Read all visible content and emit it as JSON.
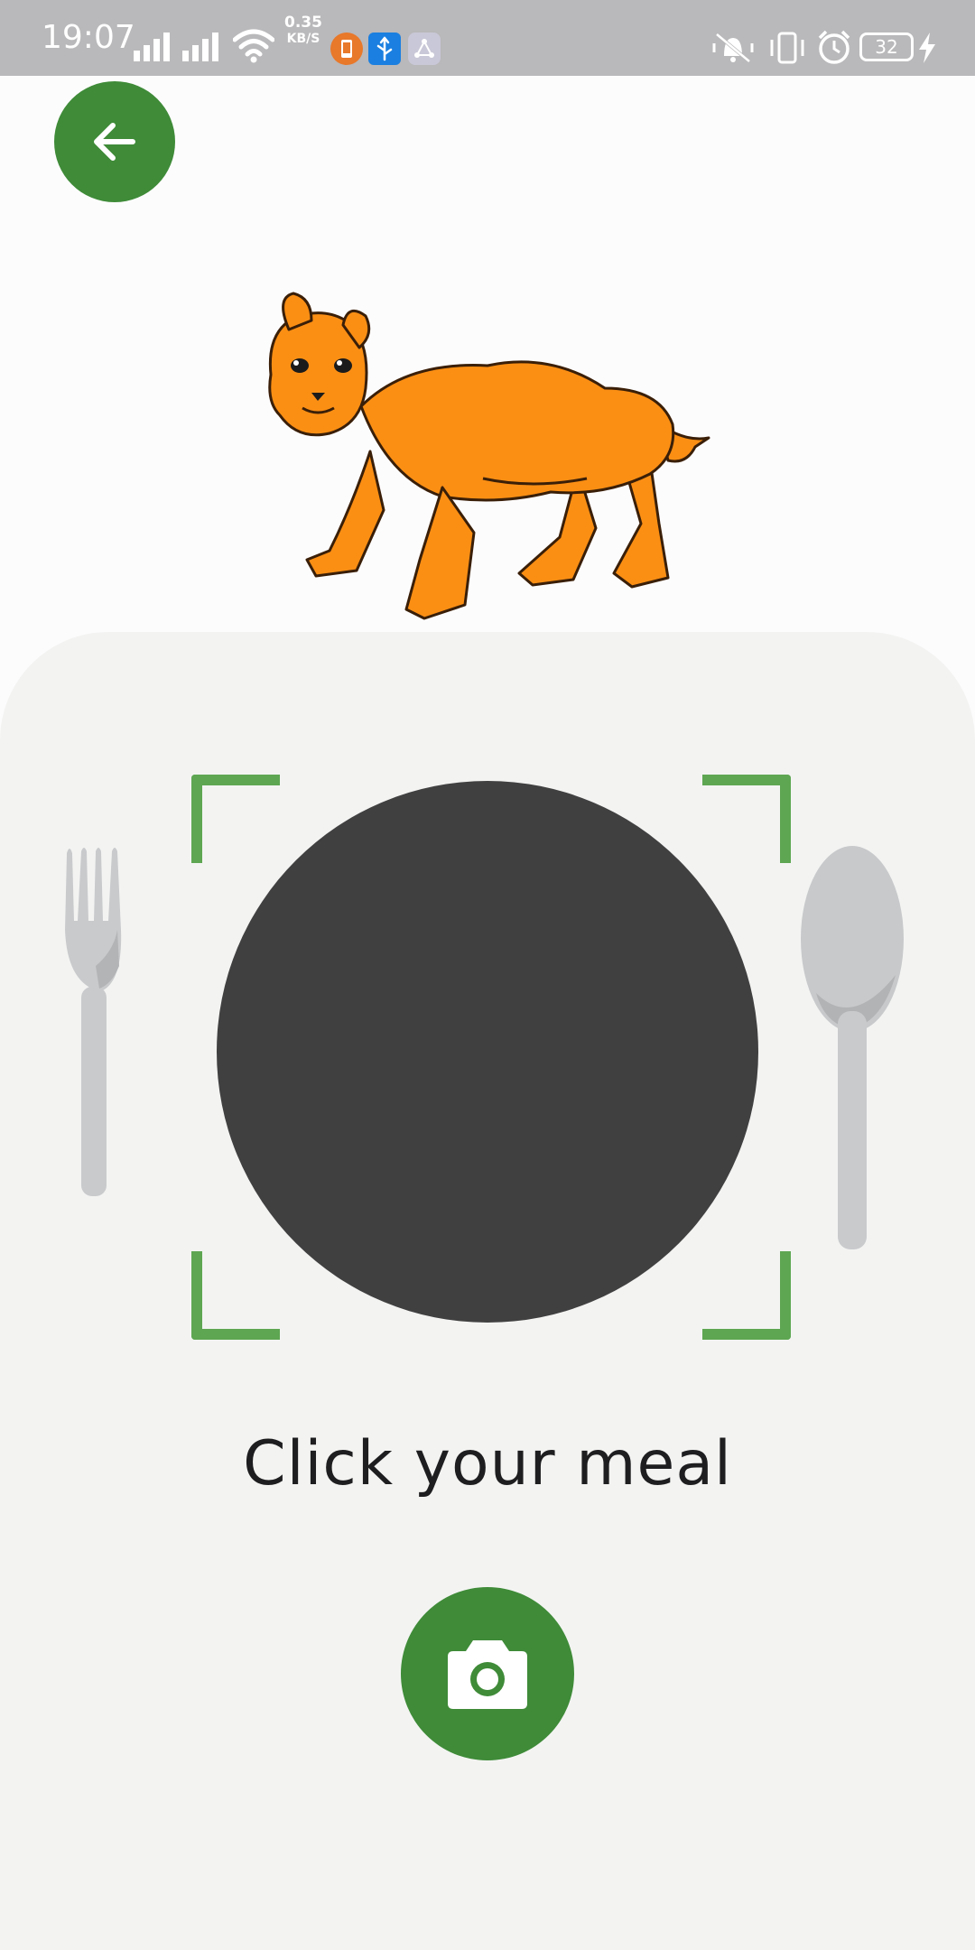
{
  "status_bar": {
    "time": "19:07",
    "network_speed_value": "0.35",
    "network_speed_unit": "KB/S",
    "battery_level": "32",
    "icons": [
      "signal-icon",
      "signal-icon",
      "wifi-icon",
      "app-notification-icon",
      "usb-icon",
      "share-icon",
      "vibrate-icon",
      "phone-rotate-icon",
      "alarm-icon",
      "battery-icon",
      "charging-icon"
    ]
  },
  "header": {
    "back_icon": "arrow-left-icon"
  },
  "main": {
    "mascot": "lion-cub-mascot",
    "prompt": "Click your meal",
    "capture_icon": "camera-icon"
  },
  "colors": {
    "primary": "#3f8b38",
    "frame": "#5ea652",
    "plate": "#414041",
    "panel": "#f3f4f2",
    "mascot": "#fb8f14"
  }
}
